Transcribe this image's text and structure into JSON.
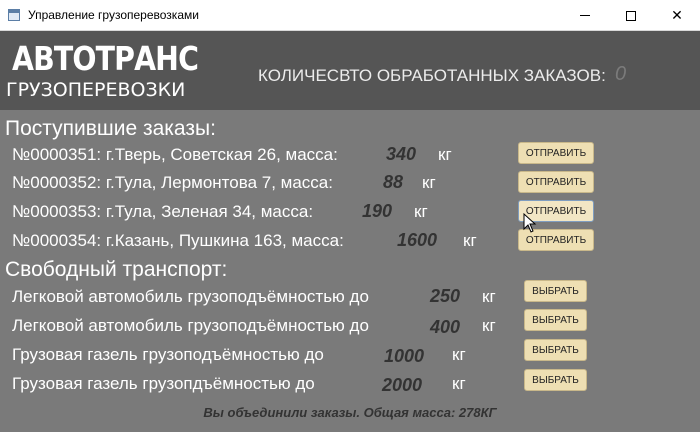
{
  "window": {
    "title": "Управление грузоперевозками"
  },
  "header": {
    "brand": "АВТОТРАНС",
    "brand_sub": "ГРУЗОПЕРЕВОЗКИ",
    "counter_label": "КОЛИЧЕСВТО ОБРАБОТАННЫХ ЗАКАЗОВ:",
    "counter_value": "0"
  },
  "orders": {
    "title": "Поступившие заказы:",
    "items": [
      {
        "text": "№0000351: г.Тверь, Советская 26, масса:",
        "mass": "340",
        "unit": "кг",
        "button": "ОТПРАВИТЬ"
      },
      {
        "text": "№0000352: г.Тула, Лермонтова 7, масса:",
        "mass": "88",
        "unit": "кг",
        "button": "ОТПРАВИТЬ"
      },
      {
        "text": "№0000353: г.Тула, Зеленая 34, масса:",
        "mass": "190",
        "unit": "кг",
        "button": "ОТПРАВИТЬ"
      },
      {
        "text": "№0000354: г.Казань, Пушкина 163, масса:",
        "mass": "1600",
        "unit": "кг",
        "button": "ОТПРАВИТЬ"
      }
    ]
  },
  "transport": {
    "title": "Свободный транспорт:",
    "items": [
      {
        "text": "Легковой автомобиль грузоподъёмностью до",
        "capacity": "250",
        "unit": "кг",
        "button": "ВЫБРАТЬ"
      },
      {
        "text": "Легковой автомобиль грузоподъёмностью до",
        "capacity": "400",
        "unit": "кг",
        "button": "ВЫБРАТЬ"
      },
      {
        "text": "Грузовая газель грузоподъёмностью до",
        "capacity": "1000",
        "unit": "кг",
        "button": "ВЫБРАТЬ"
      },
      {
        "text": "Грузовая газель грузопдъёмностью до",
        "capacity": "2000",
        "unit": "кг",
        "button": "ВЫБРАТЬ"
      }
    ]
  },
  "status": {
    "message": "Вы объединили заказы. Общая масса: 278КГ"
  }
}
